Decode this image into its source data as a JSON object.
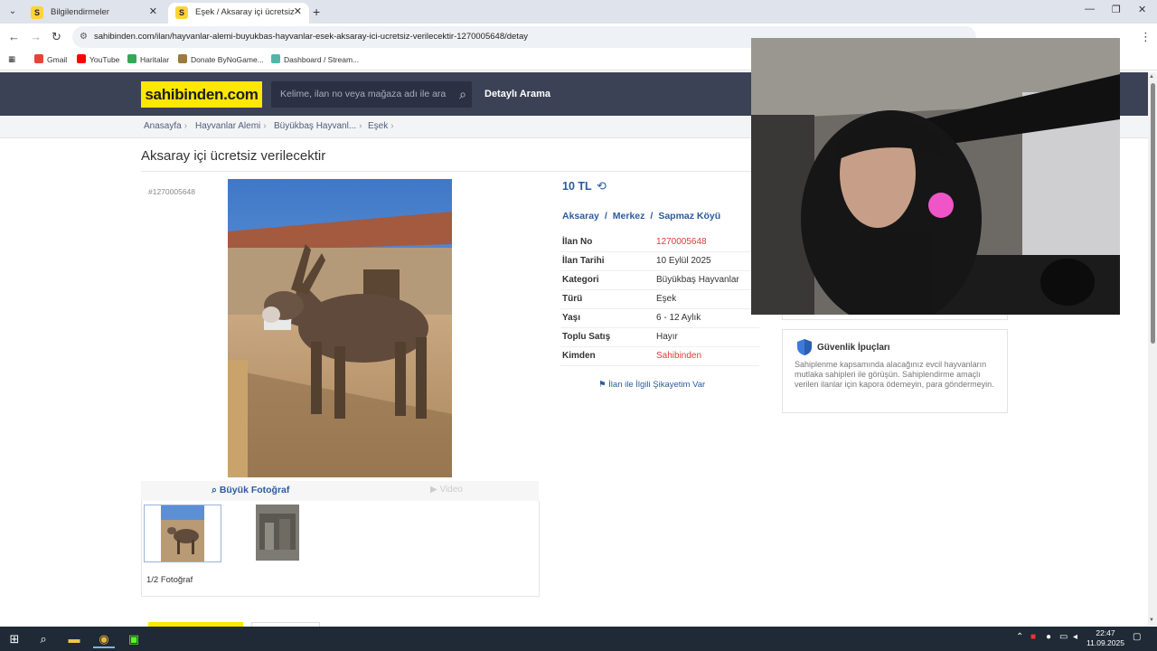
{
  "browser": {
    "tabs": [
      {
        "favicon": "S",
        "title": "Bilgilendirmeler"
      },
      {
        "favicon": "S",
        "title": "Eşek / Aksaray içi ücretsiz verile"
      }
    ],
    "url": "sahibinden.com/ilan/hayvanlar-alemi-buyukbas-hayvanlar-esek-aksaray-ici-ucretsiz-verilecektir-1270005648/detay",
    "bookmarks": [
      "Gmail",
      "YouTube",
      "Haritalar",
      "Donate ByNoGame...",
      "Dashboard / Stream..."
    ]
  },
  "site": {
    "logo": "sahibinden.com",
    "search_placeholder": "Kelime, ilan no veya mağaza adı ile ara",
    "advanced_search": "Detaylı Arama"
  },
  "breadcrumbs": [
    "Anasayfa",
    "Hayvanlar Alemi",
    "Büyükbaş Hayvanl...",
    "Eşek"
  ],
  "listing": {
    "title": "Aksaray içi ücretsiz verilecektir",
    "id_tag": "#1270005648",
    "price": "10 TL",
    "location": {
      "city": "Aksaray",
      "district": "Merkez",
      "neighborhood": "Sapmaz Köyü"
    },
    "details": [
      {
        "key": "İlan No",
        "value": "1270005648",
        "highlight": true
      },
      {
        "key": "İlan Tarihi",
        "value": "10 Eylül 2025",
        "highlight": false
      },
      {
        "key": "Kategori",
        "value": "Büyükbaş Hayvanlar",
        "highlight": false
      },
      {
        "key": "Türü",
        "value": "Eşek",
        "highlight": false
      },
      {
        "key": "Yaşı",
        "value": "6 - 12 Aylık",
        "highlight": false
      },
      {
        "key": "Toplu Satış",
        "value": "Hayır",
        "highlight": false
      },
      {
        "key": "Kimden",
        "value": "Sahibinden",
        "highlight": true
      }
    ],
    "complaint_link": "İlan ile İlgili Şikayetim Var",
    "big_photo": "Büyük Fotoğraf",
    "video": "Video",
    "photo_count": "1/2 Fotoğraf"
  },
  "safety": {
    "title": "Güvenlik İpuçları",
    "text": "Sahiplenme kapsamında alacağınız evcil hayvanların mutlaka sahipleri ile görüşün. Sahiplendirme amaçlı verilen ilanlar için kapora ödemeyin, para göndermeyin."
  },
  "taskbar": {
    "time": "22:47",
    "date": "11.09.2025"
  },
  "colors": {
    "header": "#3b4255",
    "logo_bg": "#ffe800",
    "link_blue": "#2d5a9e",
    "red": "#e03b3b"
  }
}
